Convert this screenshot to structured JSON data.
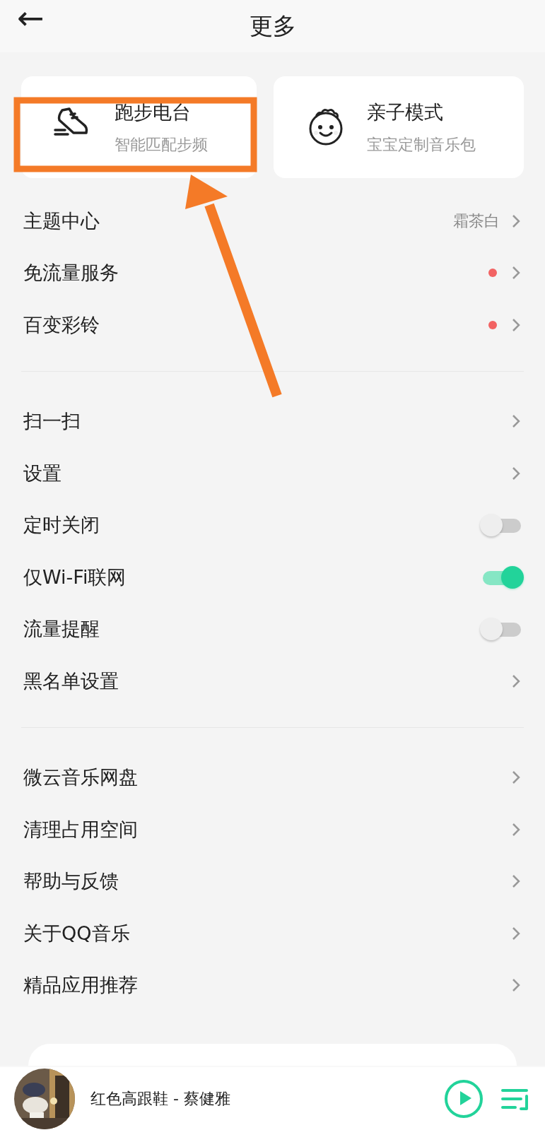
{
  "header": {
    "back": "←",
    "title": "更多"
  },
  "cards": [
    {
      "title": "跑步电台",
      "subtitle": "智能匹配步频"
    },
    {
      "title": "亲子模式",
      "subtitle": "宝宝定制音乐包"
    }
  ],
  "sections": [
    [
      {
        "kind": "arrow",
        "label": "主题中心",
        "value": "霜茶白",
        "dot": false
      },
      {
        "kind": "arrow",
        "label": "免流量服务",
        "dot": true
      },
      {
        "kind": "arrow",
        "label": "百变彩铃",
        "dot": true
      }
    ],
    [
      {
        "kind": "arrow",
        "label": "扫一扫",
        "dot": false
      },
      {
        "kind": "arrow",
        "label": "设置",
        "dot": false
      },
      {
        "kind": "switch",
        "label": "定时关闭",
        "on": false
      },
      {
        "kind": "switch",
        "label": "仅Wi-Fi联网",
        "on": true
      },
      {
        "kind": "switch",
        "label": "流量提醒",
        "on": false
      },
      {
        "kind": "arrow",
        "label": "黑名单设置",
        "dot": false
      }
    ],
    [
      {
        "kind": "arrow",
        "label": "微云音乐网盘",
        "dot": false
      },
      {
        "kind": "arrow",
        "label": "清理占用空间",
        "dot": false
      },
      {
        "kind": "arrow",
        "label": "帮助与反馈",
        "dot": false
      },
      {
        "kind": "arrow",
        "label": "关于QQ音乐",
        "dot": false
      },
      {
        "kind": "arrow",
        "label": "精品应用推荐",
        "dot": false
      }
    ]
  ],
  "player": {
    "song": "红色高跟鞋 - 蔡健雅",
    "playing": false
  },
  "annotation": {
    "highlight_box": true,
    "arrow": true
  }
}
